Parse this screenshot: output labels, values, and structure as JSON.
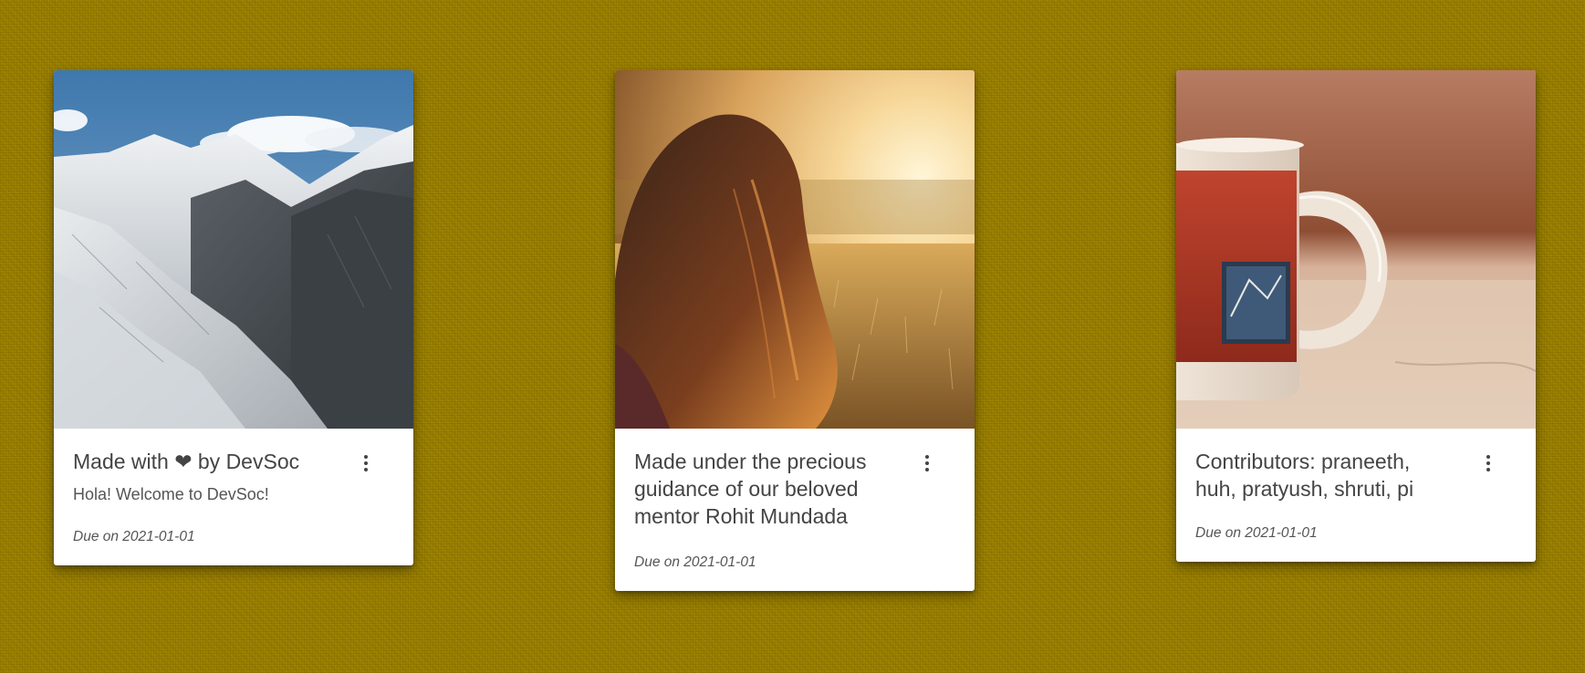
{
  "cards": [
    {
      "title_prefix": "Made with",
      "heart": "❤",
      "title_suffix": "by DevSoc",
      "text": "Hola! Welcome to DevSoc!",
      "due": "Due on 2021-01-01",
      "image_icon": "mountain-landscape-image"
    },
    {
      "title": "Made under the precious guidance of our beloved mentor Rohit Mundada",
      "due": "Due on 2021-01-01",
      "image_icon": "girl-sunset-field-image"
    },
    {
      "title": "Contributors: praneeth, huh, pratyush, shruti, pi",
      "due": "Due on 2021-01-01",
      "image_icon": "coffee-mug-image"
    }
  ],
  "colors": {
    "background": "#9a7f00",
    "card": "#ffffff",
    "text": "#444444"
  }
}
